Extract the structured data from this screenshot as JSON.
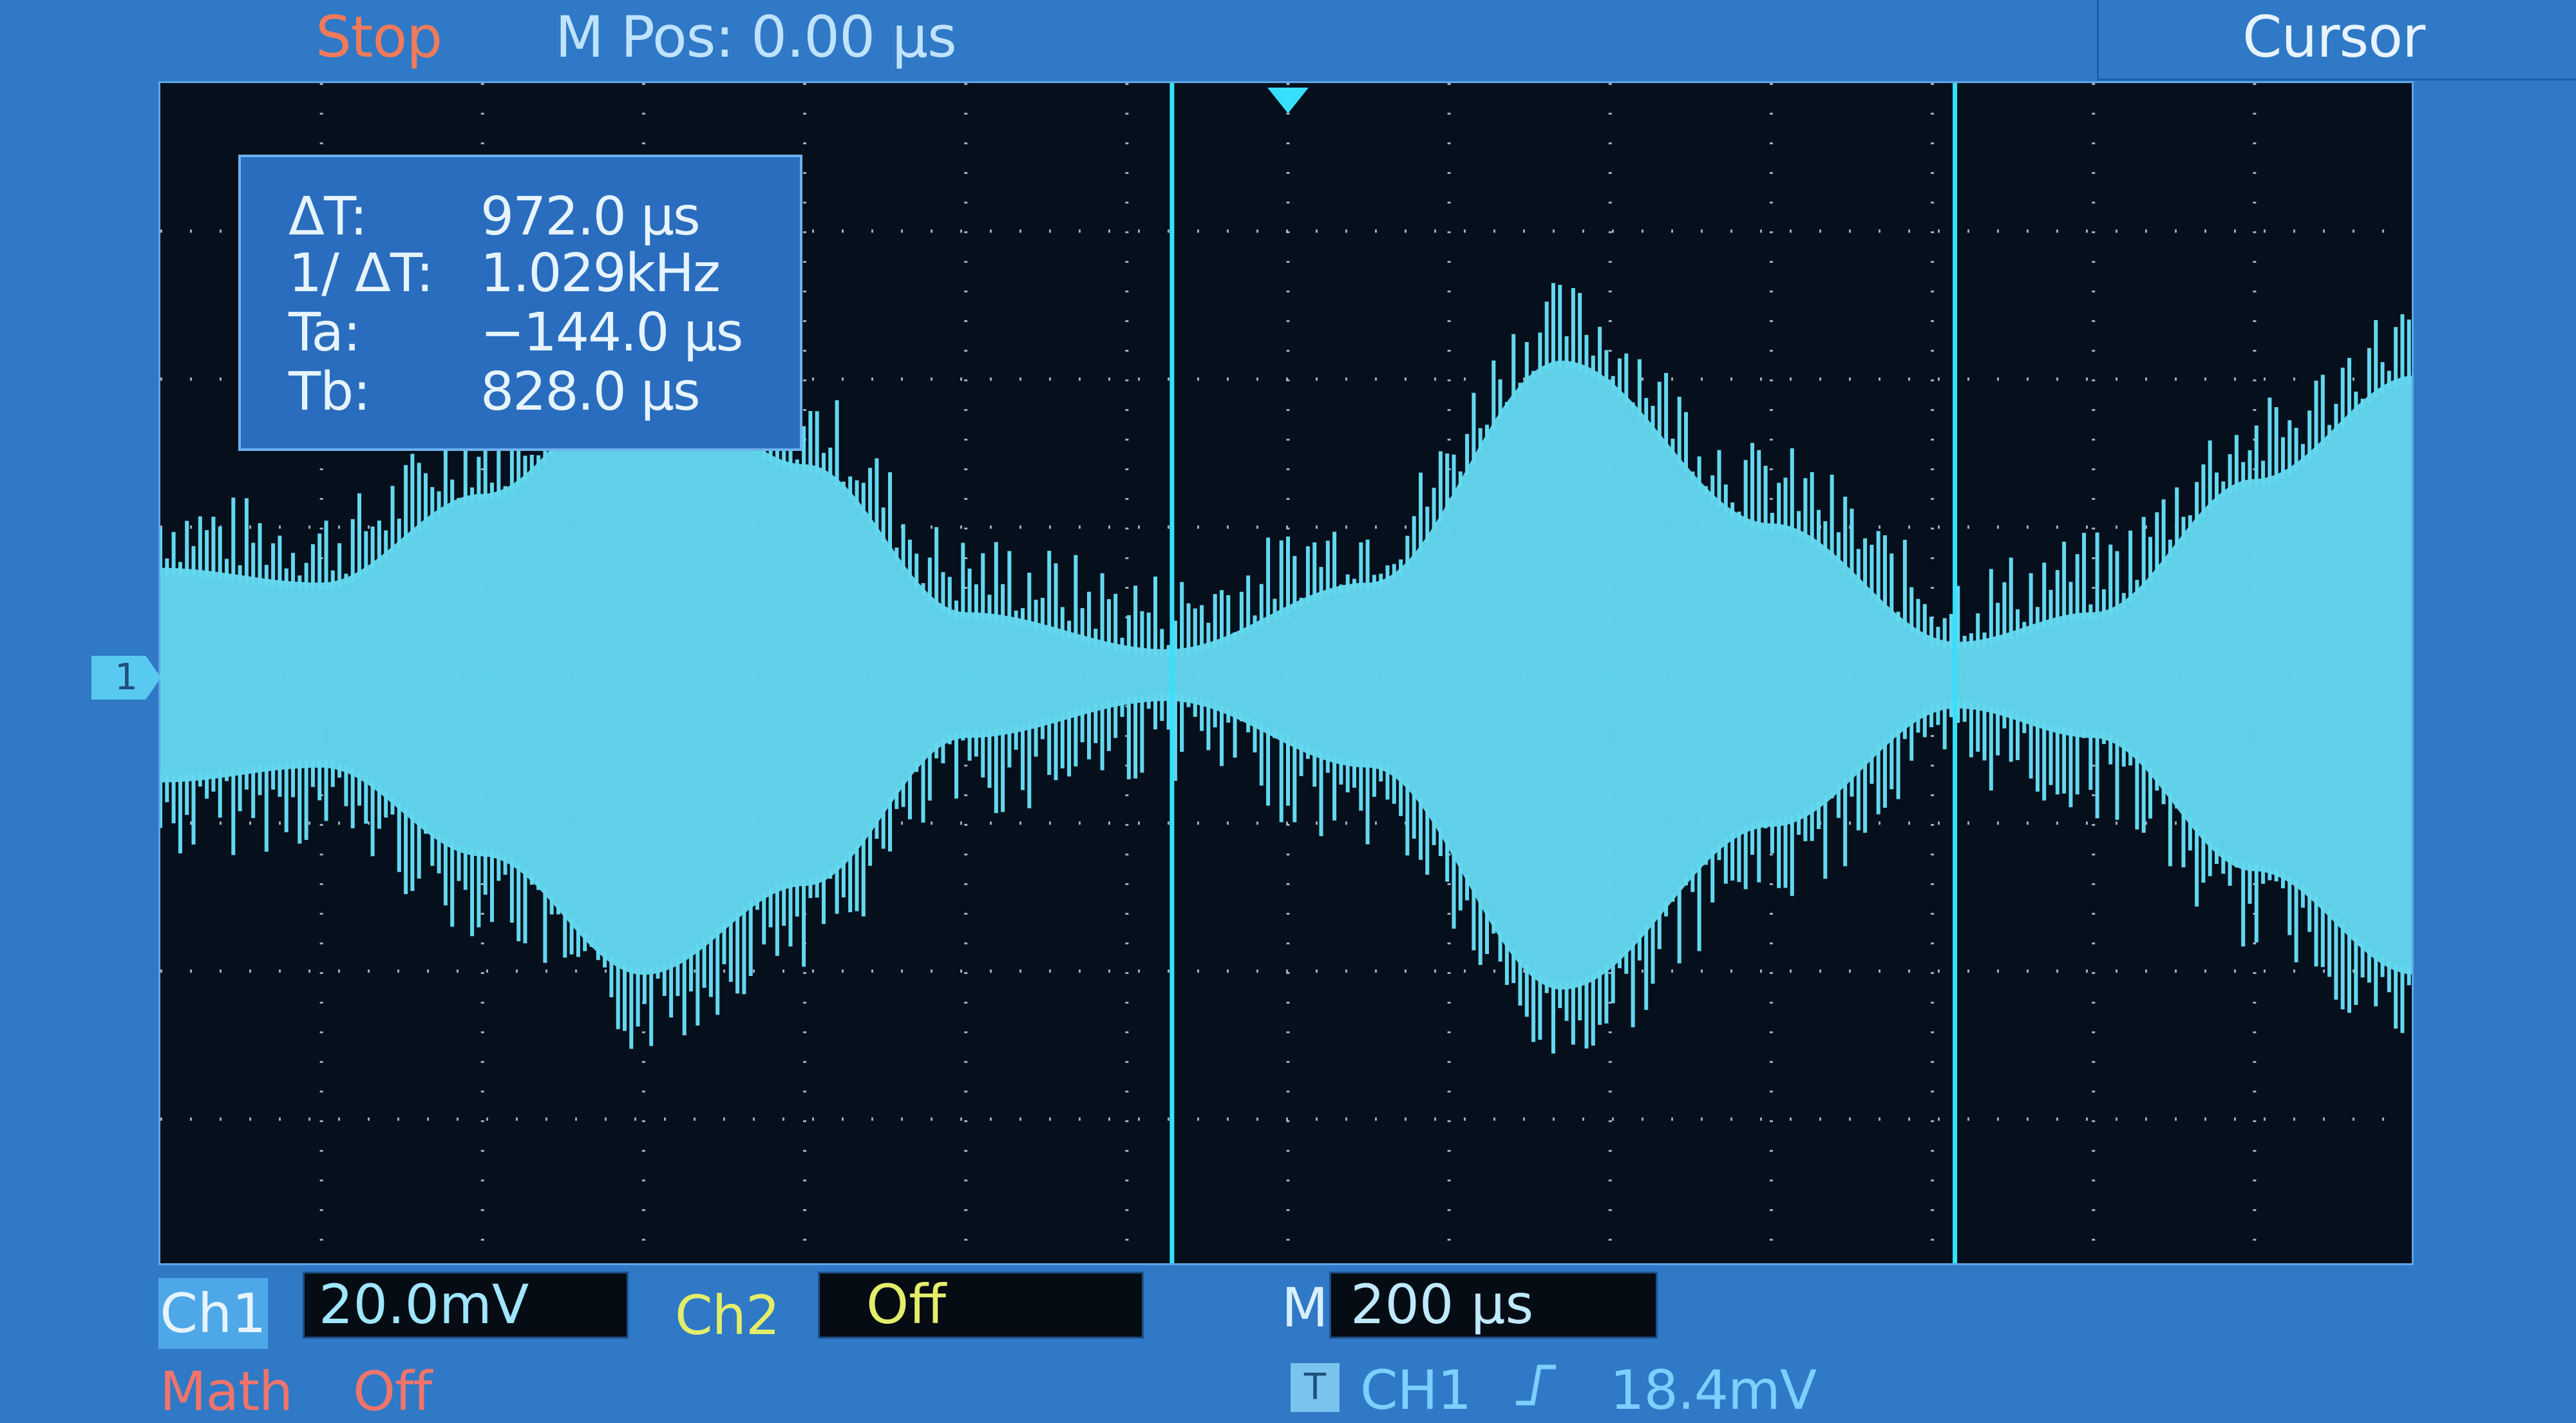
{
  "header": {
    "status": "Stop",
    "mpos": "M Pos: 0.00 µs",
    "menu_title": "Cursor"
  },
  "channel_marker": "1",
  "cursor_readout": {
    "rows": [
      {
        "label": "ΔT:",
        "value": "972.0 µs"
      },
      {
        "label": "1/ ΔT:",
        "value": "1.029kHz"
      },
      {
        "label": "Ta:",
        "value": "−144.0 µs"
      },
      {
        "label": "Tb:",
        "value": "828.0 µs"
      }
    ]
  },
  "bottom_panel": {
    "ch1_badge": "Ch1",
    "ch1_scale": "20.0mV",
    "ch2_label": "Ch2",
    "ch2_value": "Off",
    "math_label": "Math",
    "math_value": "Off",
    "timebase_prefix": "M",
    "timebase": "200 µs",
    "trigger_badge": "T",
    "trigger_source": "CH1",
    "trigger_edge": "rising-edge-icon",
    "trigger_level": "18.4mV"
  },
  "colors": {
    "bezel": "#2f79c6",
    "trace": "#63d8ef",
    "cursor_line": "#38e0ff",
    "status": "#f07a5a",
    "ch2": "#e3ed69",
    "math": "#f0746b"
  },
  "chart_data": {
    "type": "line",
    "title": "",
    "xlabel": "",
    "ylabel": "",
    "x_divisions": 14,
    "y_divisions": 8,
    "time_per_div_us": 200,
    "volts_per_div_mV": 20,
    "series": [
      {
        "points": [
          {
            "t_us": -1400,
            "env_mV": 12
          },
          {
            "t_us": -1200,
            "env_mV": 10
          },
          {
            "t_us": -1000,
            "env_mV": 22
          },
          {
            "t_us": -800,
            "env_mV": 38
          },
          {
            "t_us": -600,
            "env_mV": 26
          },
          {
            "t_us": -400,
            "env_mV": 6
          },
          {
            "t_us": -150,
            "env_mV": 1
          },
          {
            "t_us": 100,
            "env_mV": 10
          },
          {
            "t_us": 340,
            "env_mV": 40
          },
          {
            "t_us": 600,
            "env_mV": 18
          },
          {
            "t_us": 830,
            "env_mV": 2
          },
          {
            "t_us": 1000,
            "env_mV": 6
          },
          {
            "t_us": 1200,
            "env_mV": 24
          },
          {
            "t_us": 1400,
            "env_mV": 38
          }
        ]
      }
    ],
    "cursors": {
      "ta_us": -144.0,
      "tb_us": 828.0
    },
    "trigger_position_us": 0
  }
}
